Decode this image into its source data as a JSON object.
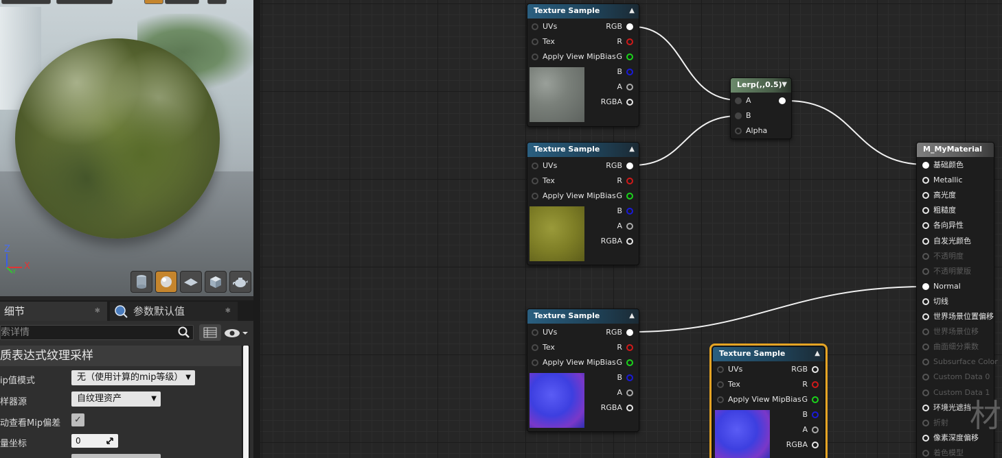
{
  "viewport": {
    "axis_labels": {
      "z": "Z",
      "x": "X",
      "y": "Y"
    },
    "preview_mode_buttons": [
      "cylinder-icon",
      "sphere-icon",
      "plane-icon",
      "cube-icon",
      "teapot-icon"
    ],
    "active_preview": "sphere-icon"
  },
  "details": {
    "tabs": [
      {
        "label": "细节"
      },
      {
        "label": "参数默认值"
      }
    ],
    "search_placeholder": "索详情",
    "section_title": "质表达式纹理采样",
    "properties": [
      {
        "label": "ip值模式",
        "value": "无（使用计算的mip等级）"
      },
      {
        "label": "样器源",
        "value": "自纹理资产"
      },
      {
        "label": "动查看Mip偏差",
        "value": "✓"
      },
      {
        "label": "量坐标",
        "value": "0"
      }
    ]
  },
  "graph": {
    "texture_nodes": [
      {
        "title": "Texture Sample",
        "inputs": [
          "UVs",
          "Tex",
          "Apply View MipBias"
        ],
        "outputs": [
          "RGB",
          "R",
          "G",
          "B",
          "A",
          "RGBA"
        ],
        "preview": "gray-stone-texture"
      },
      {
        "title": "Texture Sample",
        "inputs": [
          "UVs",
          "Tex",
          "Apply View MipBias"
        ],
        "outputs": [
          "RGB",
          "R",
          "G",
          "B",
          "A",
          "RGBA"
        ],
        "preview": "moss-texture"
      },
      {
        "title": "Texture Sample",
        "inputs": [
          "UVs",
          "Tex",
          "Apply View MipBias"
        ],
        "outputs": [
          "RGB",
          "R",
          "G",
          "B",
          "A",
          "RGBA"
        ],
        "preview": "normal-map-texture"
      },
      {
        "title": "Texture Sample",
        "inputs": [
          "UVs",
          "Tex",
          "Apply View MipBias"
        ],
        "outputs": [
          "RGB",
          "R",
          "G",
          "B",
          "A",
          "RGBA"
        ],
        "preview": "normal-map-texture"
      }
    ],
    "lerp_node": {
      "title": "Lerp(,,0.5)",
      "inputs": [
        "A",
        "B",
        "Alpha"
      ]
    },
    "material_node": {
      "title": "M_MyMaterial",
      "inputs": [
        {
          "label": "基础颜色",
          "enabled": true
        },
        {
          "label": "Metallic",
          "enabled": true
        },
        {
          "label": "高光度",
          "enabled": true
        },
        {
          "label": "粗糙度",
          "enabled": true
        },
        {
          "label": "各向异性",
          "enabled": true
        },
        {
          "label": "自发光颜色",
          "enabled": true
        },
        {
          "label": "不透明度",
          "enabled": false
        },
        {
          "label": "不透明蒙版",
          "enabled": false
        },
        {
          "label": "Normal",
          "enabled": true
        },
        {
          "label": "切线",
          "enabled": true
        },
        {
          "label": "世界场景位置偏移",
          "enabled": true
        },
        {
          "label": "世界场景位移",
          "enabled": false
        },
        {
          "label": "曲面细分乘数",
          "enabled": false
        },
        {
          "label": "Subsurface Color",
          "enabled": false
        },
        {
          "label": "Custom Data 0",
          "enabled": false
        },
        {
          "label": "Custom Data 1",
          "enabled": false
        },
        {
          "label": "环境光遮挡",
          "enabled": true
        },
        {
          "label": "折射",
          "enabled": false
        },
        {
          "label": "像素深度偏移",
          "enabled": true
        },
        {
          "label": "着色模型",
          "enabled": false
        }
      ]
    },
    "watermark": "材"
  },
  "colors": {
    "accent_orange": "#e5a424",
    "pin_red": "#d01a1a",
    "pin_green": "#1bd41b",
    "pin_blue": "#1a1ad8"
  }
}
